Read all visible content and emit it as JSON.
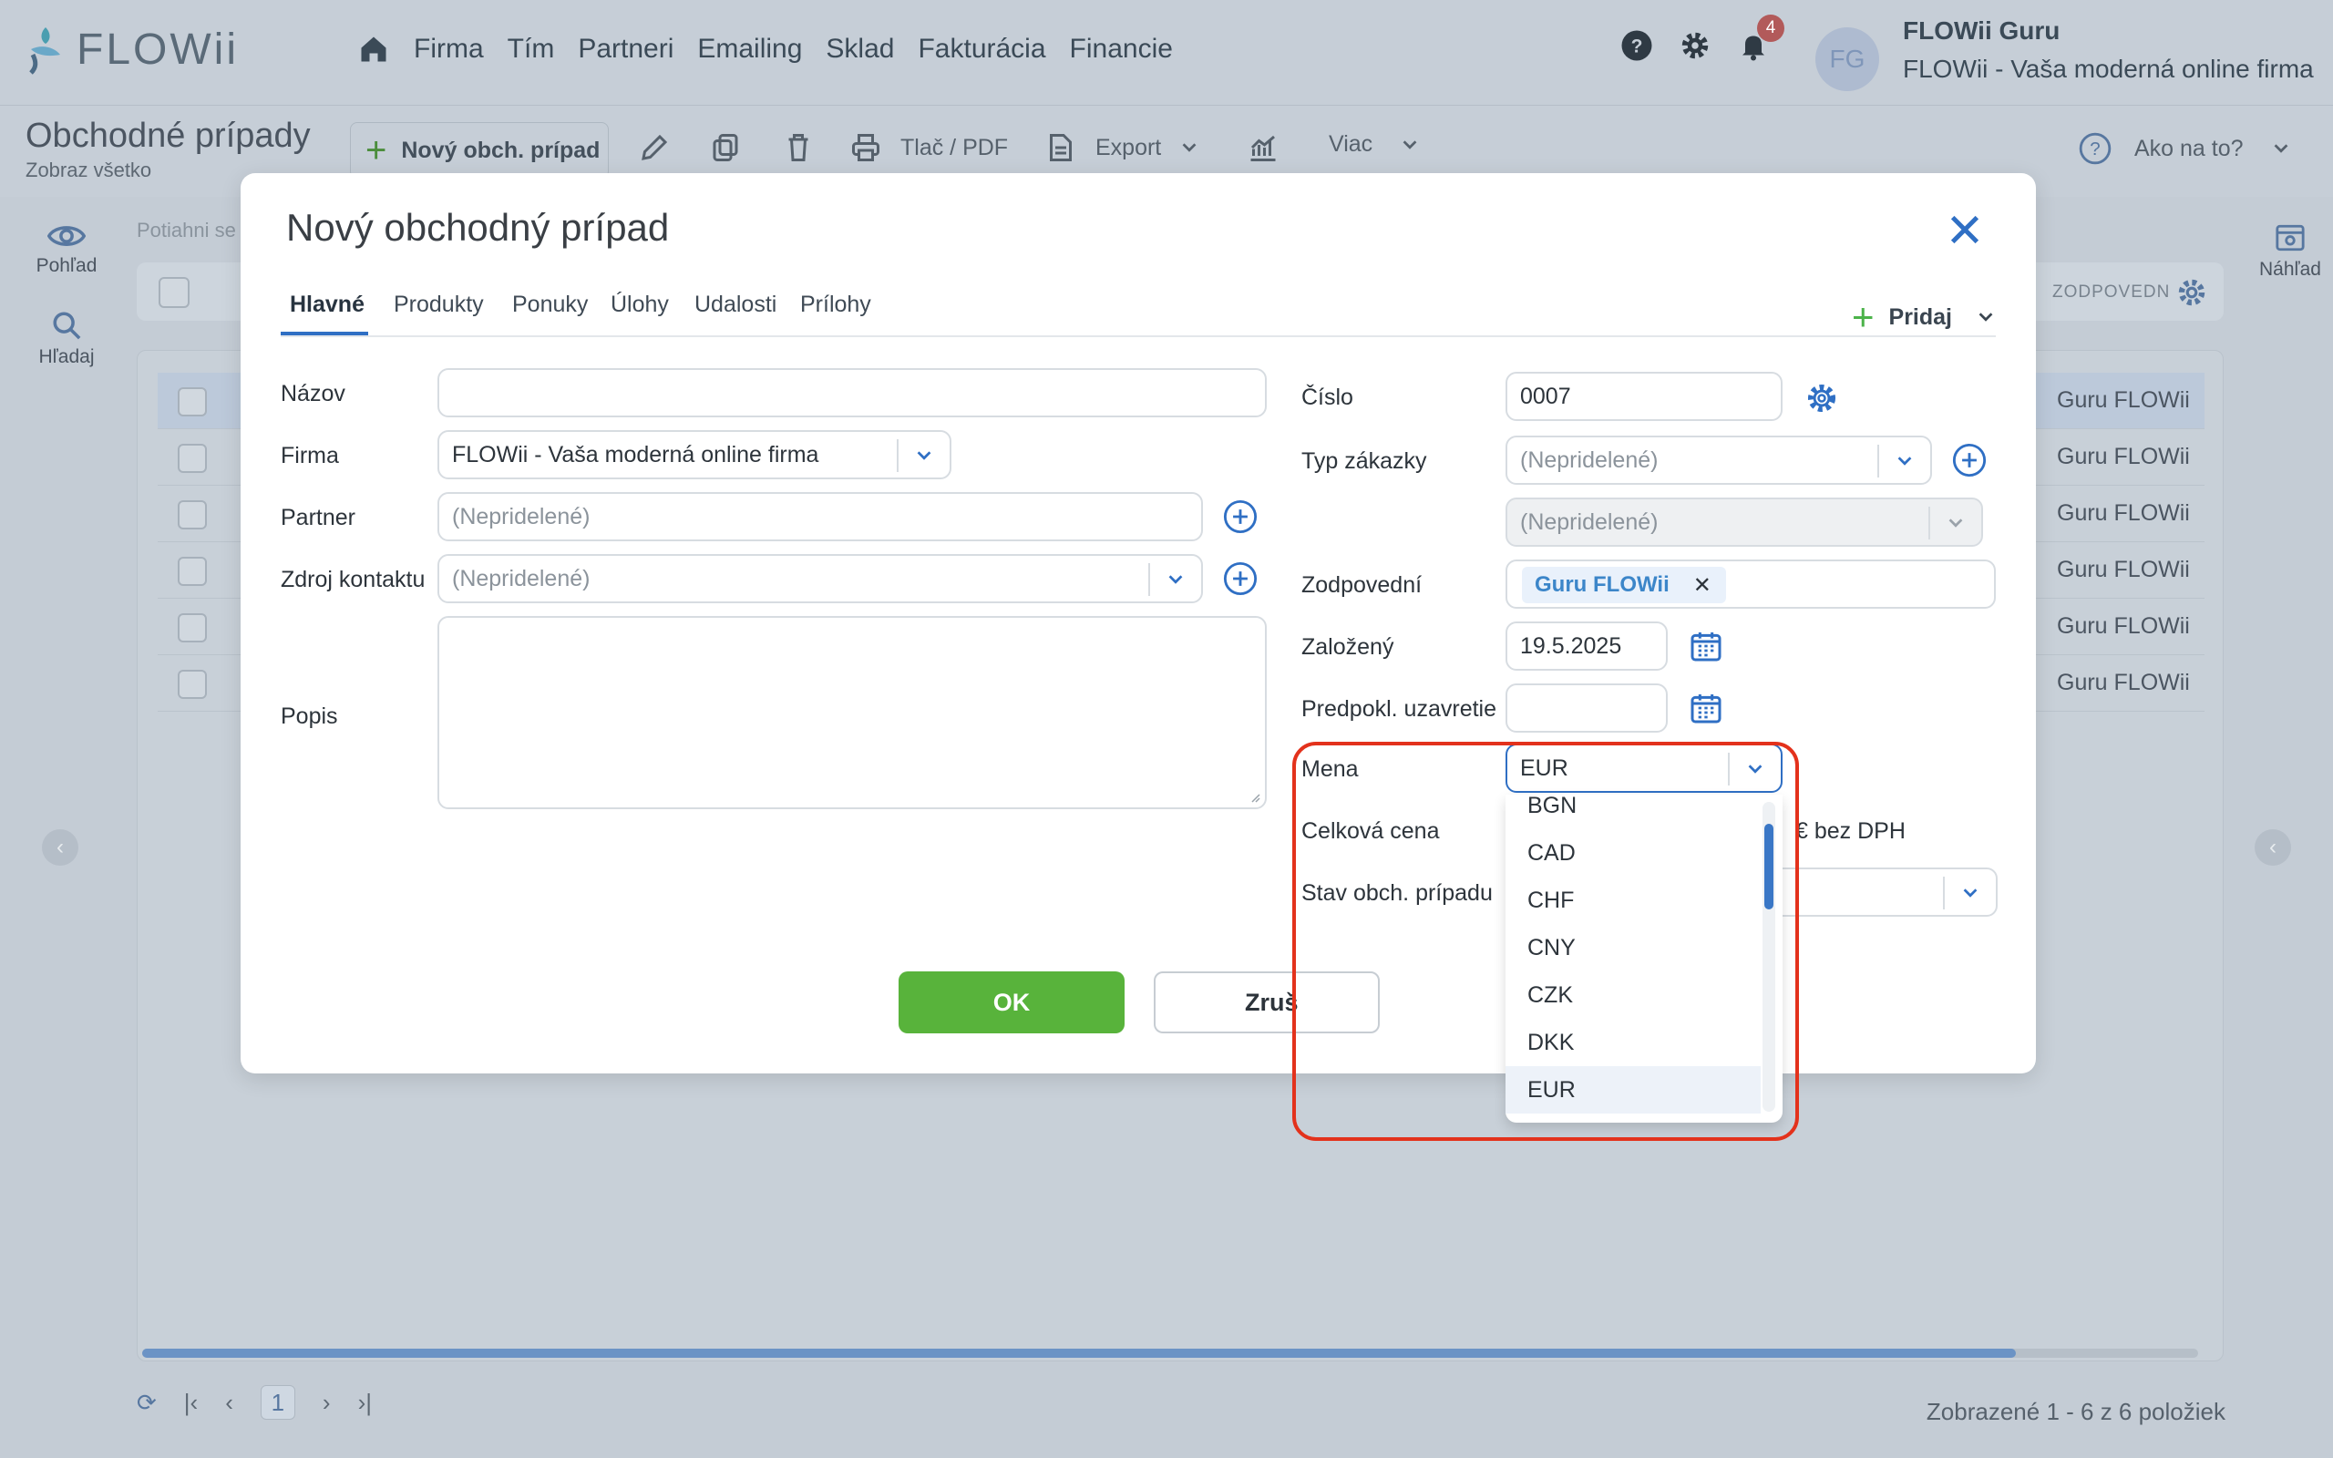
{
  "app": {
    "logo_text": "FLOWii",
    "nav": [
      "Firma",
      "Tím",
      "Partneri",
      "Emailing",
      "Sklad",
      "Fakturácia",
      "Financie"
    ],
    "notifications_count": "4",
    "user_initials": "FG",
    "user_name": "FLOWii Guru",
    "user_company": "FLOWii - Vaša moderná online firma"
  },
  "toolbar": {
    "page_title": "Obchodné prípady",
    "page_subtitle": "Zobraz všetko",
    "new_case": "Nový obch. prípad",
    "print_pdf": "Tlač / PDF",
    "export": "Export",
    "more": "Viac",
    "how_to": "Ako na to?"
  },
  "sidebar": {
    "view": "Pohľad",
    "search": "Hľadaj",
    "preview": "Náhľad"
  },
  "grid": {
    "drag_hint": "Potiahni se",
    "responsible_col": "ZODPOVEDN",
    "rows": [
      "Guru FLOWii",
      "Guru FLOWii",
      "Guru FLOWii",
      "Guru FLOWii",
      "Guru FLOWii",
      "Guru FLOWii"
    ],
    "page": "1",
    "shown_text": "Zobrazené 1 - 6 z 6 položiek"
  },
  "modal": {
    "title": "Nový obchodný prípad",
    "tabs": [
      "Hlavné",
      "Produkty",
      "Ponuky",
      "Úlohy",
      "Udalosti",
      "Prílohy"
    ],
    "add_label": "Pridaj",
    "labels": {
      "name": "Názov",
      "company": "Firma",
      "partner": "Partner",
      "contact_source": "Zdroj kontaktu",
      "description": "Popis",
      "number": "Číslo",
      "order_type": "Typ zákazky",
      "responsible": "Zodpovední",
      "founded": "Založený",
      "expected_close": "Predpokl. uzavretie",
      "currency": "Mena",
      "total_price": "Celková cena",
      "case_state": "Stav obch. prípadu"
    },
    "values": {
      "name": "",
      "company": "FLOWii - Vaša moderná online firma",
      "partner": "(Nepridelené)",
      "contact_source": "(Nepridelené)",
      "number": "0007",
      "order_type": "(Nepridelené)",
      "order_subtype": "(Nepridelené)",
      "responsible_chip": "Guru FLOWii",
      "founded": "19.5.2025",
      "expected_close": "",
      "currency": "EUR",
      "total_suffix": "€ bez DPH"
    },
    "ok": "OK",
    "cancel": "Zruš",
    "currency_options": [
      "BGN",
      "CAD",
      "CHF",
      "CNY",
      "CZK",
      "DKK",
      "EUR"
    ],
    "currency_selected": "EUR",
    "accent_color": "#2f6fc4",
    "ok_color": "#58b33b",
    "highlight_color": "#e3321c"
  }
}
